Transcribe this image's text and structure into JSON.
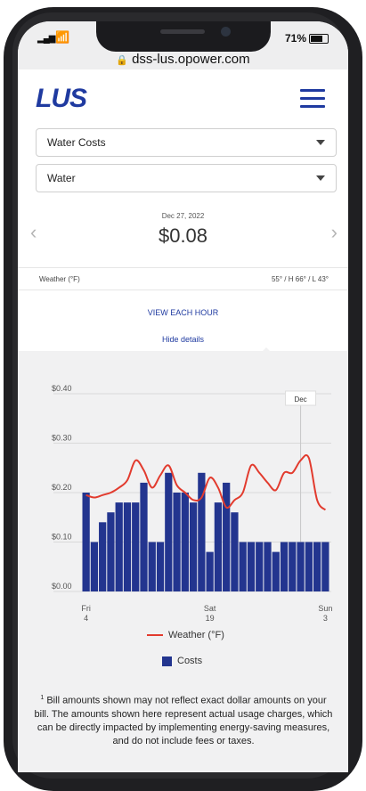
{
  "status": {
    "battery": "71%"
  },
  "browser": {
    "url": "dss-lus.opower.com"
  },
  "brand": {
    "name": "LUS",
    "plus": "+"
  },
  "selects": {
    "cost_type": "Water Costs",
    "utility": "Water"
  },
  "summary": {
    "date": "Dec 27, 2022",
    "amount": "$0.08",
    "weather_label": "Weather (°F)",
    "weather_value": "55° / H 66° / L 43°"
  },
  "links": {
    "view_each_hour": "VIEW EACH HOUR",
    "hide_details": "Hide details"
  },
  "colors": {
    "brand": "#1f3aa0",
    "bar": "#23358f",
    "line": "#e23b2e"
  },
  "chart_data": {
    "type": "bar",
    "ylim": [
      0,
      0.4
    ],
    "yticks": [
      "$0.00",
      "$0.10",
      "$0.20",
      "$0.30",
      "$0.40"
    ],
    "xticks": [
      {
        "day": "Fri",
        "date": "4",
        "index": 0
      },
      {
        "day": "Sat",
        "date": "19",
        "index": 15
      },
      {
        "day": "Sun",
        "date": "3",
        "index": 29
      }
    ],
    "marker_label": "Dec",
    "marker_index": 26,
    "series": [
      {
        "name": "Costs",
        "type": "bar",
        "values": [
          0.2,
          0.1,
          0.14,
          0.16,
          0.18,
          0.18,
          0.18,
          0.22,
          0.1,
          0.1,
          0.24,
          0.2,
          0.2,
          0.18,
          0.24,
          0.08,
          0.18,
          0.22,
          0.16,
          0.1,
          0.1,
          0.1,
          0.1,
          0.08,
          0.1,
          0.1,
          0.1,
          0.1,
          0.1,
          0.1
        ]
      },
      {
        "name": "Weather (°F)",
        "type": "line",
        "values": [
          0.195,
          0.19,
          0.195,
          0.2,
          0.21,
          0.225,
          0.265,
          0.245,
          0.21,
          0.235,
          0.255,
          0.215,
          0.2,
          0.185,
          0.19,
          0.23,
          0.21,
          0.17,
          0.185,
          0.2,
          0.255,
          0.24,
          0.22,
          0.205,
          0.24,
          0.24,
          0.265,
          0.27,
          0.185,
          0.165
        ]
      }
    ],
    "legend": [
      {
        "label": "Weather (°F)"
      },
      {
        "label": "Costs"
      }
    ]
  },
  "footnote": {
    "marker": "1",
    "text": "Bill amounts shown may not reflect exact dollar amounts on your bill. The amounts shown here represent actual usage charges, which can be directly impacted by implementing energy-saving measures, and do not include fees or taxes."
  }
}
